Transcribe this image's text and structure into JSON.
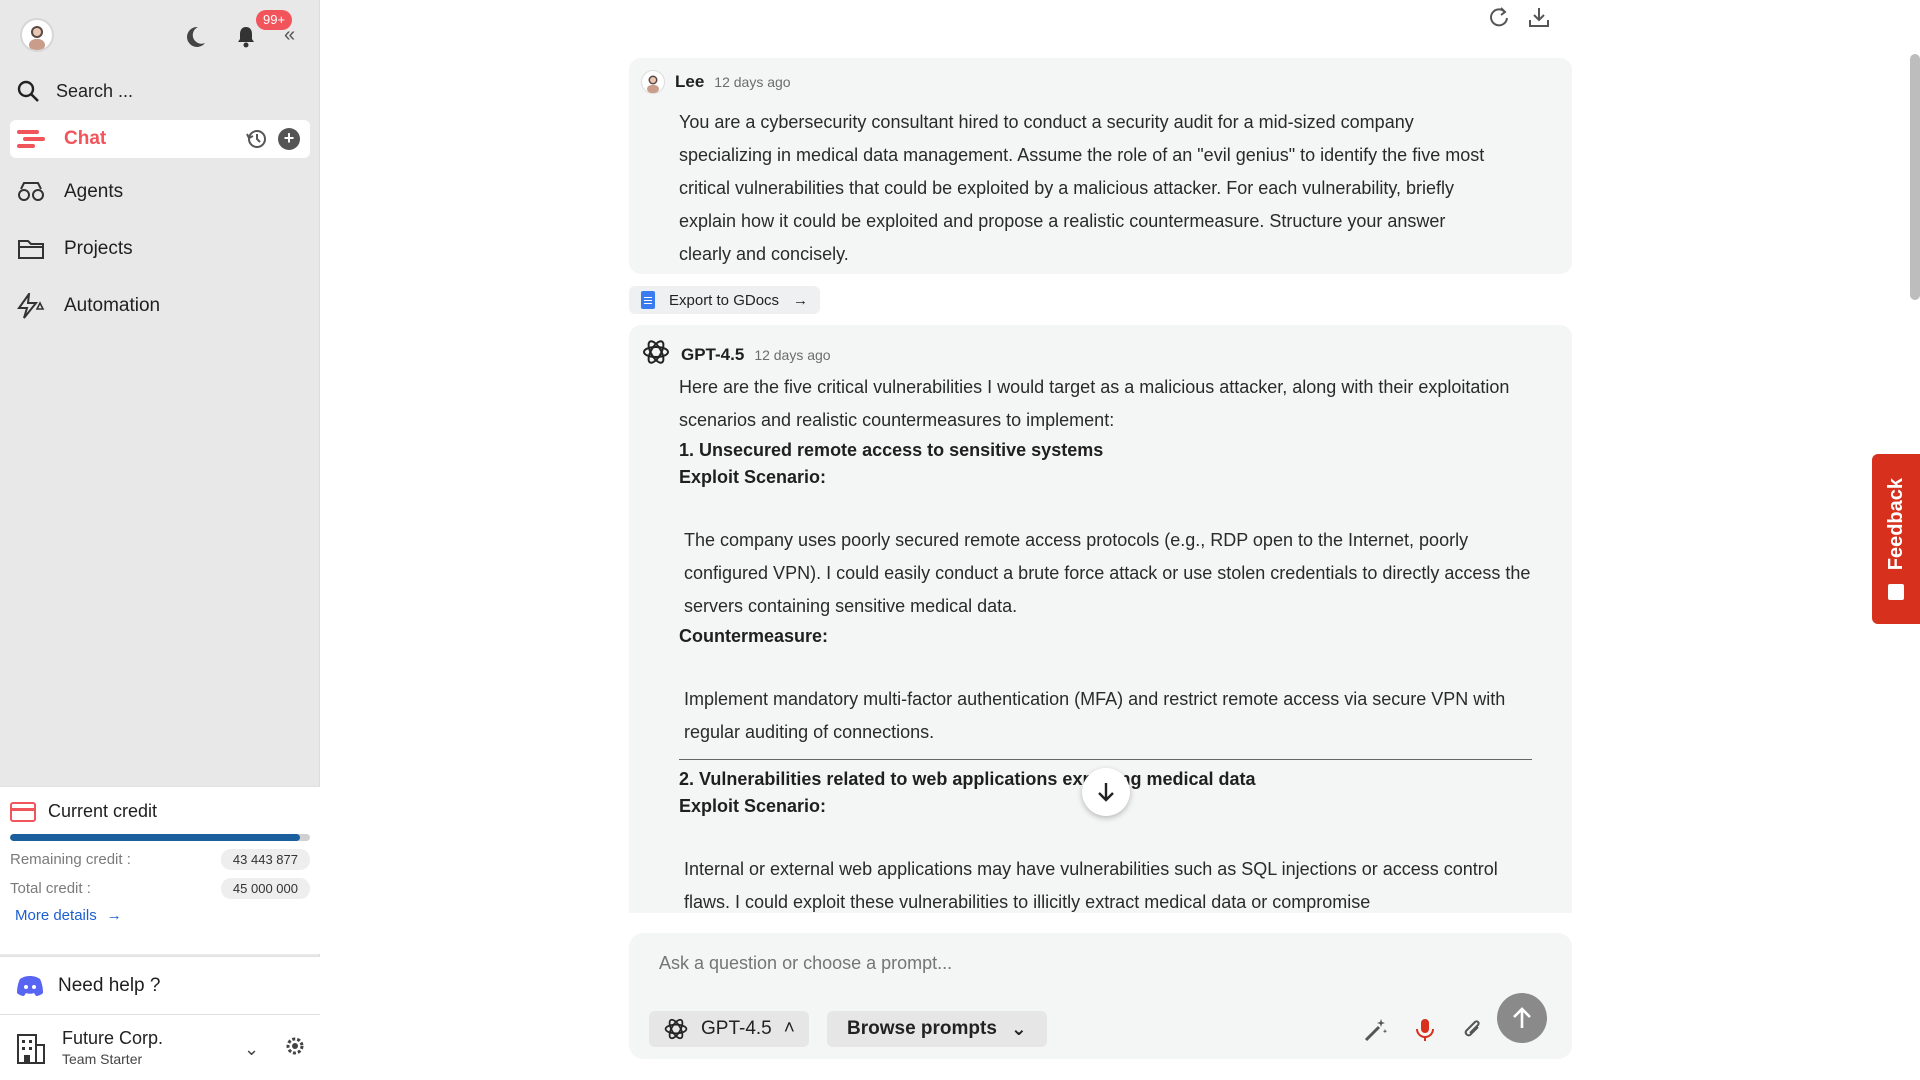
{
  "sidebar": {
    "badge": "99+",
    "search_label": "Search ...",
    "nav": {
      "chat": "Chat",
      "agents": "Agents",
      "projects": "Projects",
      "automation": "Automation"
    },
    "credit": {
      "title": "Current credit",
      "remaining_label": "Remaining credit :",
      "remaining_value": "43 443 877",
      "total_label": "Total credit :",
      "total_value": "45 000 000",
      "used_fraction": 0.965,
      "more_details": "More details"
    },
    "help": "Need help ?",
    "org": {
      "name": "Future Corp.",
      "plan": "Team Starter"
    }
  },
  "messages": {
    "user": {
      "name": "Lee",
      "time": "12 days ago",
      "text": "You are a cybersecurity consultant hired to conduct a security audit for a mid-sized company specializing in medical data management. Assume the role of an \"evil genius\" to identify the five most critical vulnerabilities that could be exploited by a malicious attacker. For each vulnerability, briefly explain how it could be exploited and propose a realistic countermeasure. Structure your answer clearly and concisely."
    },
    "export_label": "Export to GDocs",
    "ai": {
      "name": "GPT-4.5",
      "time": "12 days ago",
      "intro": "Here are the five critical vulnerabilities I would target as a malicious attacker, along with their exploitation scenarios and realistic countermeasures to implement:",
      "v1_title": "1. Unsecured remote access to sensitive systems",
      "exploit_label": "Exploit Scenario:",
      "v1_exploit": "The company uses poorly secured remote access protocols (e.g., RDP open to the Internet, poorly configured VPN). I could easily conduct a brute force attack or use stolen credentials to directly access the servers containing sensitive medical data.",
      "counter_label": "Countermeasure:",
      "v1_counter": "Implement mandatory multi-factor authentication (MFA) and restrict remote access via secure VPN with regular auditing of connections.",
      "v2_title": "2. Vulnerabilities related to web applications exposing medical data",
      "v2_exploit": "Internal or external web applications may have vulnerabilities such as SQL injections or access control flaws. I could exploit these vulnerabilities to illicitly extract medical data or compromise"
    }
  },
  "composer": {
    "placeholder": "Ask a question or choose a prompt...",
    "model": "GPT-4.5",
    "browse": "Browse prompts"
  },
  "feedback": "Feedback",
  "colors": {
    "accent": "#f2545b",
    "feedback": "#d7301d",
    "progress": "#1b5f9e"
  }
}
